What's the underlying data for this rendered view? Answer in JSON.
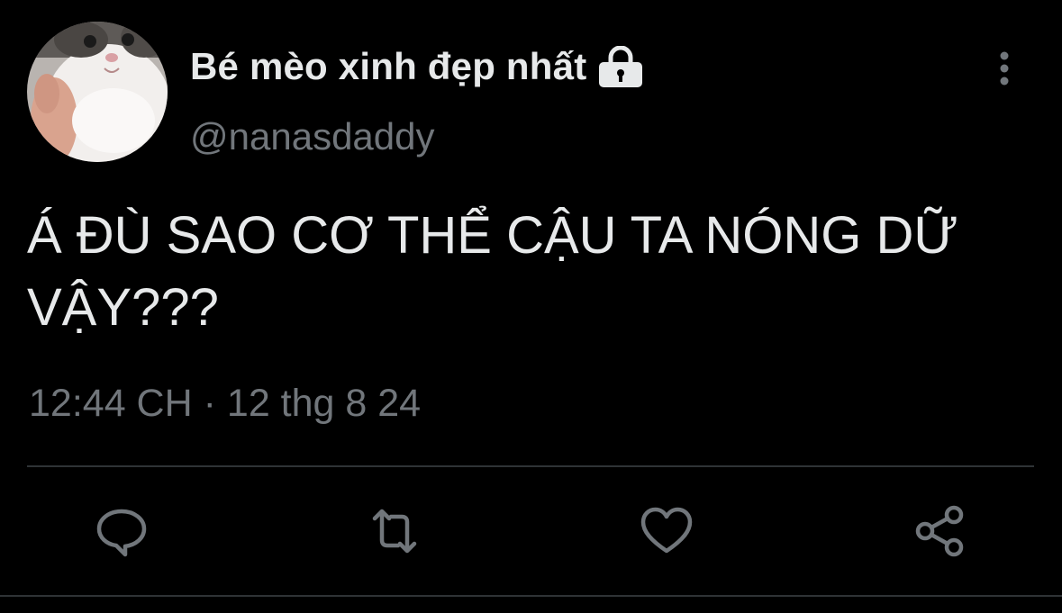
{
  "tweet": {
    "author": {
      "display_name": "Bé mèo xinh đẹp nhất",
      "handle": "@nanasdaddy",
      "protected_icon": "lock-icon",
      "avatar": "cat-avatar"
    },
    "text": "Á ĐÙ SAO CƠ THỂ CẬU TA NÓNG DỮ VẬY???",
    "timestamp": {
      "time": "12:44 CH",
      "separator": "·",
      "date": "12 thg 8 24"
    },
    "actions": [
      {
        "name": "reply",
        "icon": "comment-icon"
      },
      {
        "name": "retweet",
        "icon": "retweet-icon"
      },
      {
        "name": "like",
        "icon": "heart-icon"
      },
      {
        "name": "share",
        "icon": "share-icon"
      }
    ],
    "more_icon": "more-vertical-icon"
  },
  "colors": {
    "background": "#000000",
    "primary_text": "#e7e9ea",
    "secondary_text": "#71767b",
    "divider": "#2f3336"
  }
}
